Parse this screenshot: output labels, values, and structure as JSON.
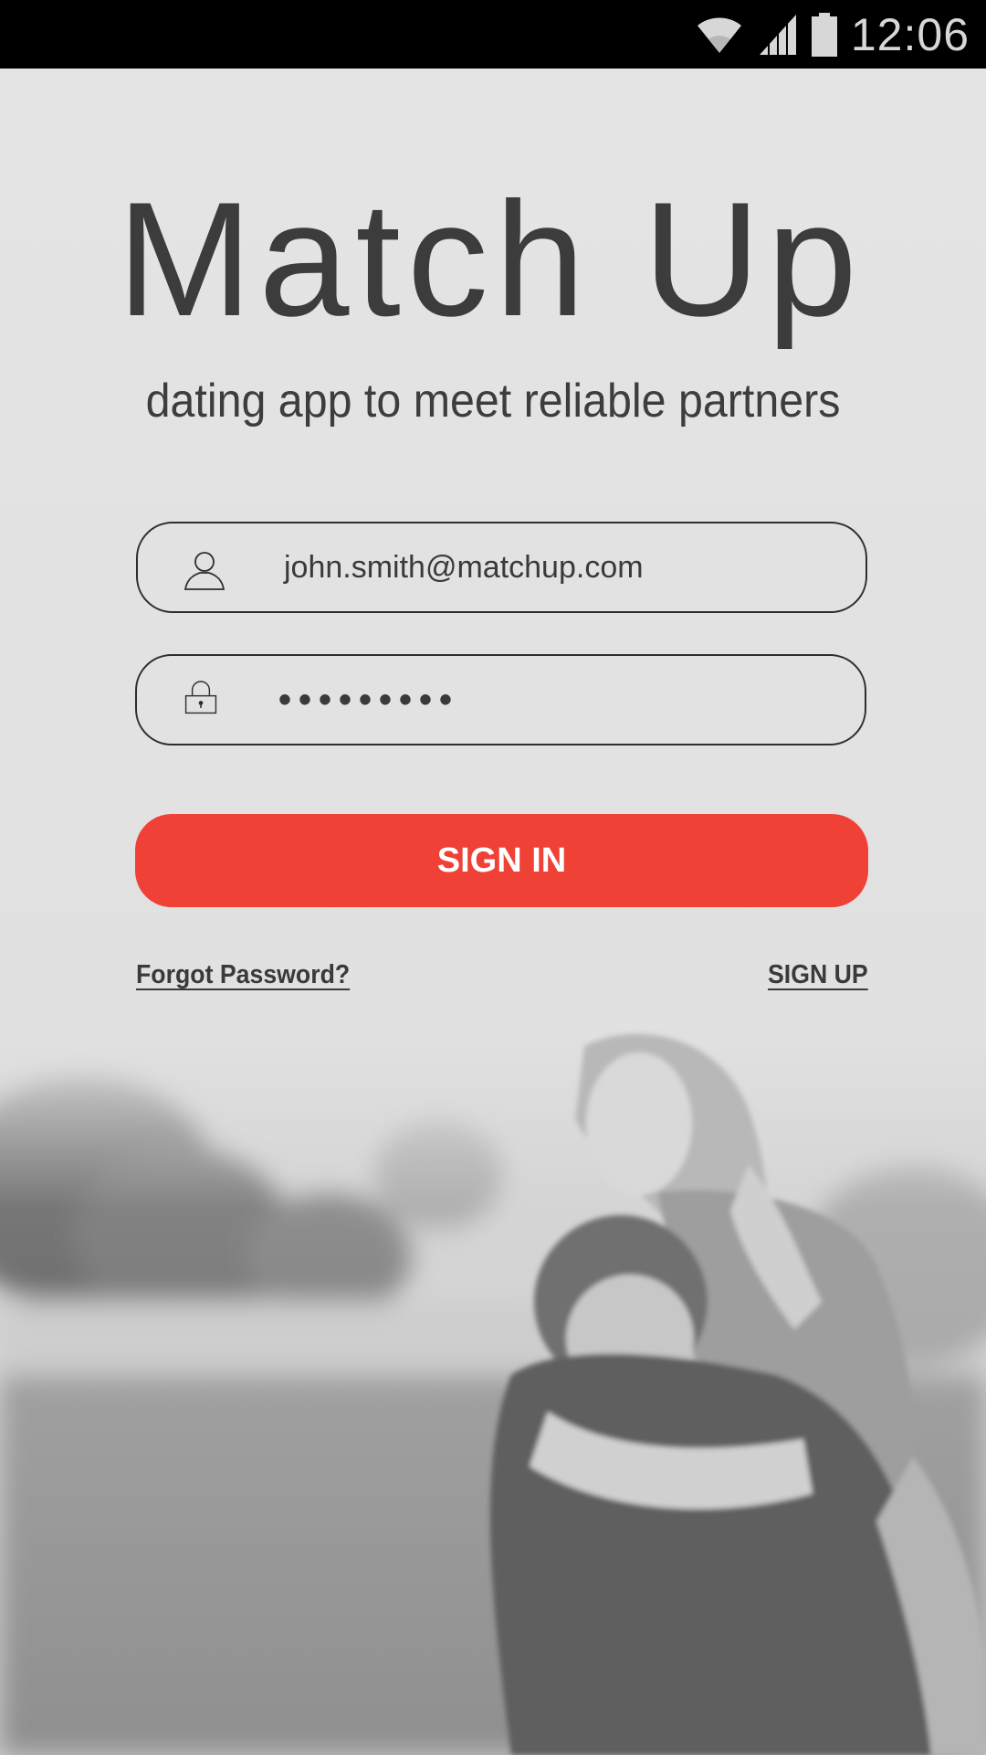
{
  "status_bar": {
    "time": "12:06",
    "icons": [
      "wifi-icon",
      "signal-icon",
      "battery-icon"
    ]
  },
  "app": {
    "title": "Match Up",
    "tagline": "dating app to meet reliable partners"
  },
  "login_form": {
    "email_value": "john.smith@matchup.com",
    "password_mask": "•••••••••",
    "email_icon": "user-icon",
    "password_icon": "lock-icon"
  },
  "actions": {
    "sign_in_label": "SIGN IN",
    "forgot_password_label": "Forgot Password?",
    "sign_up_label": "SIGN UP"
  },
  "colors": {
    "accent": "#ef4136",
    "background": "#e3e3e3",
    "text": "#3c3c3c"
  }
}
